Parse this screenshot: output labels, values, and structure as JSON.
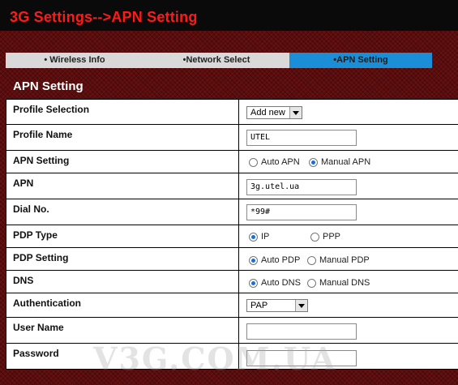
{
  "header": {
    "title": "3G Settings-->APN Setting"
  },
  "tabs": [
    {
      "label": "• Wireless Info"
    },
    {
      "label": "•Network Select"
    },
    {
      "label": "•APN Setting",
      "active": true
    }
  ],
  "section_title": "APN Setting",
  "form": {
    "profile_selection": {
      "label": "Profile Selection",
      "value": "Add new"
    },
    "profile_name": {
      "label": "Profile Name",
      "value": "UTEL"
    },
    "apn_setting": {
      "label": "APN Setting",
      "opt1": "Auto APN",
      "opt2": "Manual APN",
      "selected": "Manual APN"
    },
    "apn": {
      "label": "APN",
      "value": "3g.utel.ua"
    },
    "dial_no": {
      "label": "Dial No.",
      "value": "*99#"
    },
    "pdp_type": {
      "label": "PDP Type",
      "opt1": "IP",
      "opt2": "PPP",
      "selected": "IP"
    },
    "pdp_setting": {
      "label": "PDP Setting",
      "opt1": "Auto PDP",
      "opt2": "Manual PDP",
      "selected": "Auto PDP"
    },
    "dns": {
      "label": "DNS",
      "opt1": "Auto DNS",
      "opt2": "Manual DNS",
      "selected": "Auto DNS"
    },
    "authentication": {
      "label": "Authentication",
      "value": "PAP"
    },
    "user_name": {
      "label": "User Name",
      "value": ""
    },
    "password": {
      "label": "Password",
      "value": ""
    }
  },
  "watermark": "V3G.COM.UA",
  "colors": {
    "title_red": "#ff1a1a",
    "active_tab": "#1a8ed6",
    "background": "#5a0d0d"
  }
}
